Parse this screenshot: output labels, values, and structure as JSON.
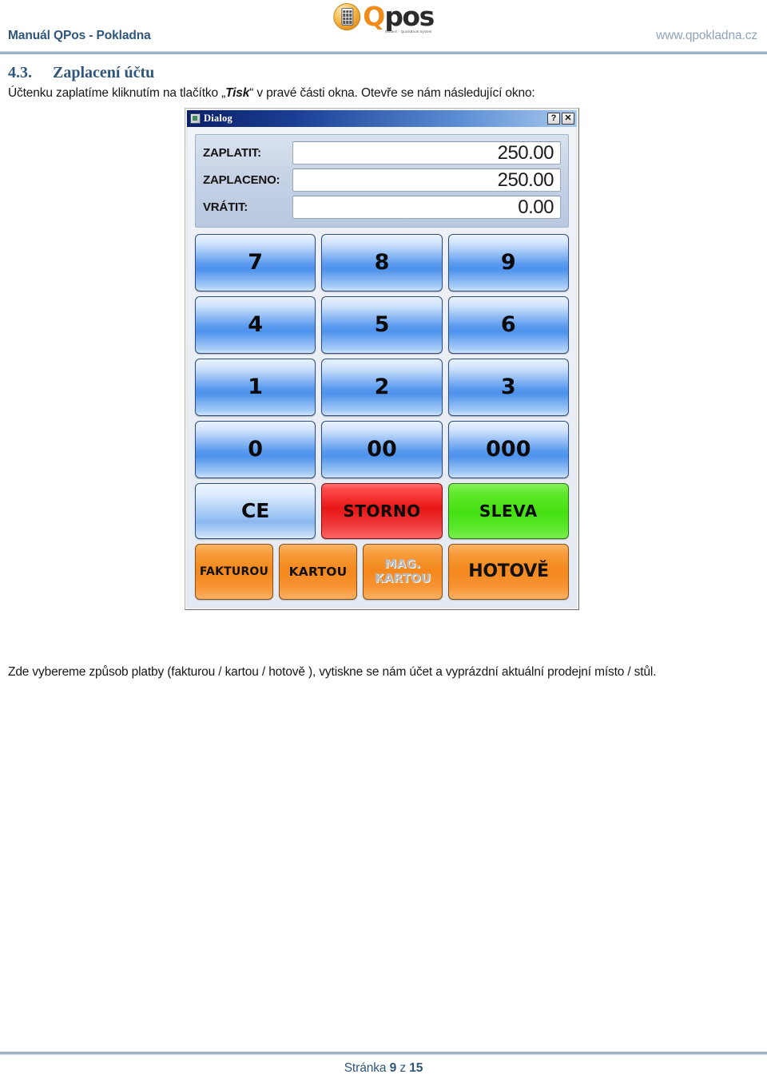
{
  "header": {
    "left_title": "Manuál QPos - Pokladna",
    "website": "www.qpokladna.cz",
    "logo": {
      "mark": "Q",
      "word": "pos",
      "tagline": "Modern · QuickBook System"
    }
  },
  "section": {
    "number": "4.3.",
    "title": "Zaplacení účtu",
    "intro_before": "Účtenku zaplatíme kliknutím na tlačítko „",
    "intro_emphasis": "Tisk",
    "intro_after": "“ v pravé části okna. Otevře se nám následující okno:"
  },
  "dialog": {
    "titlebar": {
      "title": "Dialog",
      "help_label": "?",
      "close_label": "✕",
      "icon": "window-icon"
    },
    "fields": [
      {
        "label": "ZAPLATIT:",
        "value": "250.00",
        "name": "zaplatit"
      },
      {
        "label": "ZAPLACENO:",
        "value": "250.00",
        "name": "zaplaceno"
      },
      {
        "label": "VRÁTIT:",
        "value": "0.00",
        "name": "vratit"
      }
    ],
    "keypad": {
      "rows": [
        [
          "7",
          "8",
          "9"
        ],
        [
          "4",
          "5",
          "6"
        ],
        [
          "1",
          "2",
          "3"
        ],
        [
          "0",
          "00",
          "000"
        ]
      ],
      "action_row": [
        {
          "label": "CE",
          "style": "blue"
        },
        {
          "label": "STORNO",
          "style": "red"
        },
        {
          "label": "SLEVA",
          "style": "green"
        }
      ]
    },
    "payment_buttons": [
      {
        "label": "FAKTUROU",
        "state": "enabled"
      },
      {
        "label": "KARTOU",
        "state": "enabled"
      },
      {
        "label": "MAG. KARTOU",
        "line1": "MAG.",
        "line2": "KARTOU",
        "state": "disabled"
      },
      {
        "label": "HOTOVĚ",
        "state": "enabled"
      }
    ]
  },
  "body_text": "Zde vybereme způsob platby (fakturou / kartou / hotově ), vytiskne se nám účet a vyprázdní aktuální prodejní místo / stůl.",
  "footer": {
    "page_word": "Stránka",
    "page_current": "9",
    "page_of": "z",
    "page_total": "15"
  },
  "colors": {
    "brand_blue": "#2f5579",
    "brand_orange": "#f08c1b",
    "rule": "#9db3c8",
    "storno_red": "#e81616",
    "sleva_green": "#45e011",
    "payment_orange": "#f3881d"
  }
}
